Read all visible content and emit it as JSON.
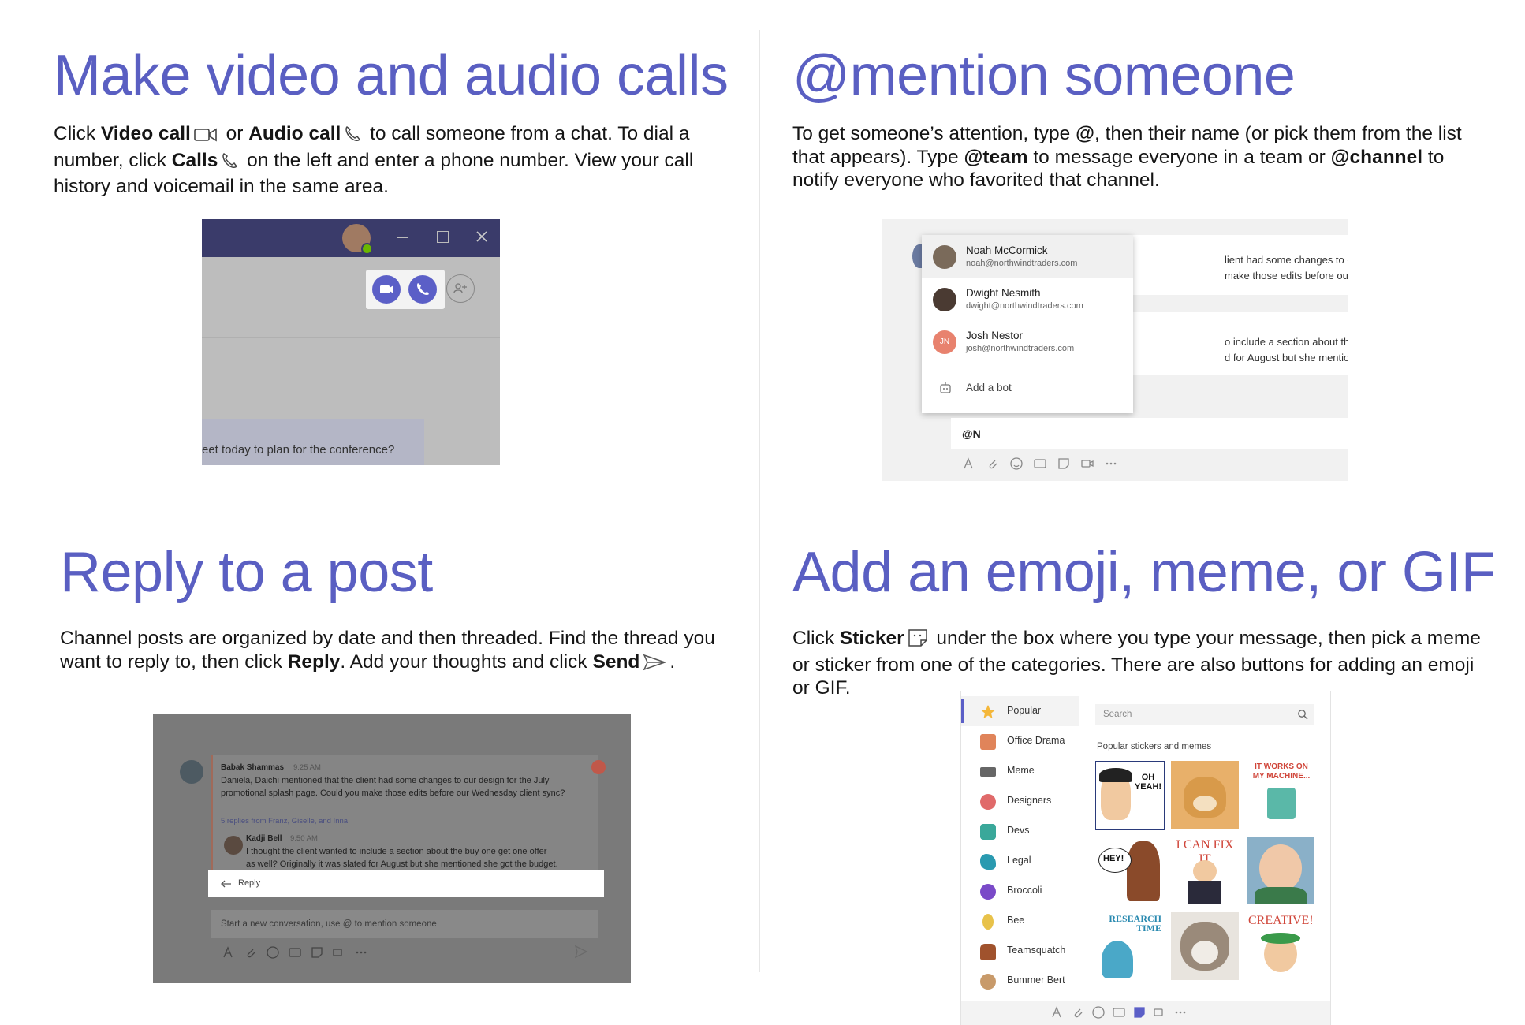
{
  "sections": {
    "calls": {
      "title": "Make video and audio calls",
      "t1": "Click ",
      "b1": "Video call",
      "t2": " or ",
      "b2": "Audio call",
      "t3": " to call someone from a chat. To dial a number, click ",
      "b3": "Calls",
      "t4": " on the left and enter a phone number. View your call history and voicemail in the same area."
    },
    "mention": {
      "title": "@mention someone",
      "t1": "To get someone’s attention, type ",
      "b1": "@",
      "t2": ", then their name (or pick them from the list that appears). Type ",
      "b2": "@team",
      "t3": " to message everyone in a team or ",
      "b3": "@channel",
      "t4": " to notify everyone who favorited that channel."
    },
    "reply": {
      "title": "Reply to a post",
      "t1": "Channel posts are organized by date and then threaded. Find the thread you want to reply to, then click ",
      "b1": "Reply",
      "t2": ". Add your thoughts and click ",
      "b2": "Send",
      "t3": "."
    },
    "emoji": {
      "title": "Add an emoji, meme, or GIF",
      "t1": "Click ",
      "b1": "Sticker",
      "t2": " under the box where you type your message, then pick a meme or sticker from one of the categories. There are also buttons for adding an emoji or GIF."
    }
  },
  "shot_calls": {
    "chat_snippet": "eet today to plan for the conference?"
  },
  "shot_mention": {
    "msg1_line1": "lient had some changes to our design for the J",
    "msg1_line2": "make those edits before our Wednesday clien",
    "msg2_line1": "o include a section about the buy one get one",
    "msg2_line2": "d for August but she mentioned she got the b",
    "people": [
      {
        "name": "Noah McCormick",
        "email": "noah@northwindtraders.com",
        "color": "#7a6a5a"
      },
      {
        "name": "Dwight Nesmith",
        "email": "dwight@northwindtraders.com",
        "color": "#4a3a32"
      },
      {
        "name": "Josh Nestor",
        "email": "josh@northwindtraders.com",
        "color": "#e8826e",
        "initials": "JN"
      }
    ],
    "add_bot": "Add a bot",
    "compose_text": "@N"
  },
  "shot_reply": {
    "author1": "Babak Shammas",
    "time1": "9:25 AM",
    "msg1_line1": "Daniela, Daichi mentioned that the client had some changes to our design for the July",
    "msg1_line2": "promotional splash page. Could you make those edits before our Wednesday client sync?",
    "replies": "5 replies from Franz, Giselle, and Inna",
    "author2": "Kadji Bell",
    "time2": "9:50 AM",
    "msg2_line1": "I thought the client wanted to include a section about the buy one get one offer",
    "msg2_line2": "as well? Originally it was slated for August but she mentioned she got the budget.",
    "reply_label": "Reply",
    "new_conv": "Start a new conversation, use @ to mention someone"
  },
  "shot_emoji": {
    "categories": [
      "Popular",
      "Office Drama",
      "Meme",
      "Designers",
      "Devs",
      "Legal",
      "Broccoli",
      "Bee",
      "Teamsquatch",
      "Bummer Bert"
    ],
    "search_placeholder": "Search",
    "section_label": "Popular stickers and memes",
    "stickers": [
      "OH YEAH!",
      "",
      "IT WORKS ON MY MACHINE...",
      "HEY!",
      "I CAN FIX IT",
      "",
      "RESEARCH TIME",
      "",
      "CREATIVE!"
    ]
  },
  "colors": {
    "accent": "#5a5fc2",
    "teams_purple": "#5b5fc7",
    "titlebar": "#3a3b6a"
  }
}
